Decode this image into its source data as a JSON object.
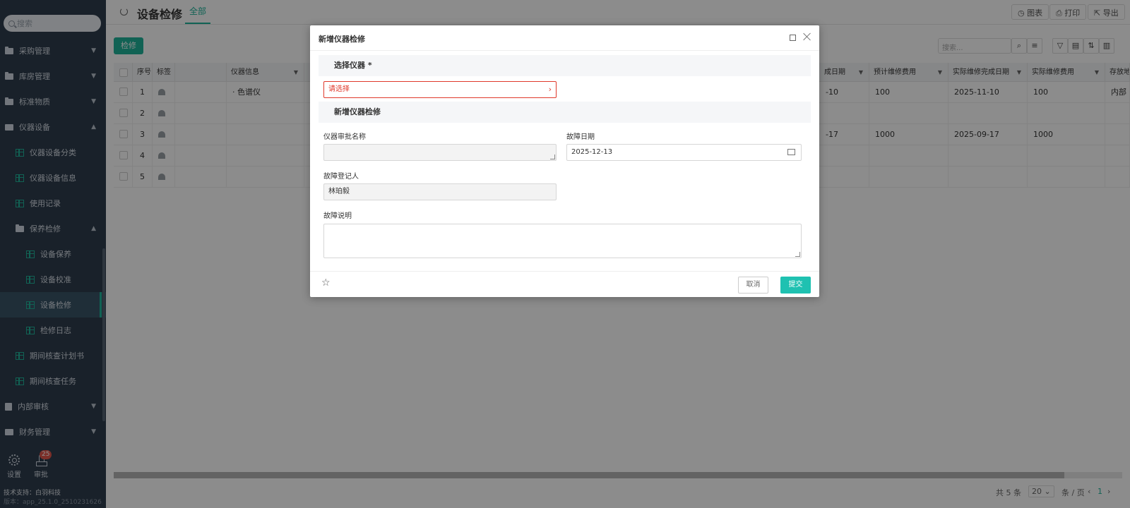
{
  "sidebar": {
    "search_placeholder": "搜索",
    "items": [
      {
        "label": "采购管理"
      },
      {
        "label": "库房管理"
      },
      {
        "label": "标准物质"
      },
      {
        "label": "仪器设备"
      },
      {
        "label": "仪器设备分类"
      },
      {
        "label": "仪器设备信息"
      },
      {
        "label": "使用记录"
      },
      {
        "label": "保养检修"
      },
      {
        "label": "设备保养"
      },
      {
        "label": "设备校准"
      },
      {
        "label": "设备检修"
      },
      {
        "label": "检修日志"
      },
      {
        "label": "期间核查计划书"
      },
      {
        "label": "期间核查任务"
      },
      {
        "label": "内部审核"
      },
      {
        "label": "财务管理"
      }
    ],
    "settings_label": "设置",
    "approve_label": "审批",
    "approve_badge": "25",
    "footer_support": "技术支持：白羽科技",
    "footer_version": "版本：app_25.1.0_2510231626..."
  },
  "topbar": {
    "title": "设备检修",
    "tab": "全部",
    "chart_btn": "◷ 图表",
    "print_btn": "⎙ 打印",
    "export_btn": "⇱ 导出"
  },
  "toolbar": {
    "repair_btn": "检修",
    "search_placeholder": "搜索..."
  },
  "table": {
    "headers": {
      "seq": "序号",
      "tag": "标签",
      "instrument": "仪器信息",
      "complete_date": "成日期",
      "est_cost": "预计维修费用",
      "actual_date": "实际维修完成日期",
      "actual_cost": "实际维修费用",
      "storage": "存放地"
    },
    "rows": [
      {
        "seq": "1",
        "instrument": "· 色谱仪",
        "complete_date": "-10",
        "est_cost": "100",
        "actual_date": "2025-11-10",
        "actual_cost": "100",
        "storage": "内部"
      },
      {
        "seq": "2",
        "instrument": "",
        "complete_date": "",
        "est_cost": "",
        "actual_date": "",
        "actual_cost": "",
        "storage": ""
      },
      {
        "seq": "3",
        "instrument": "",
        "complete_date": "-17",
        "est_cost": "1000",
        "actual_date": "2025-09-17",
        "actual_cost": "1000",
        "storage": ""
      },
      {
        "seq": "4",
        "instrument": "",
        "complete_date": "",
        "est_cost": "",
        "actual_date": "",
        "actual_cost": "",
        "storage": ""
      },
      {
        "seq": "5",
        "instrument": "",
        "complete_date": "",
        "est_cost": "",
        "actual_date": "",
        "actual_cost": "",
        "storage": ""
      }
    ]
  },
  "pager": {
    "total": "共 5 条",
    "page_size": "20",
    "per_page": "条 / 页",
    "page": "1"
  },
  "modal": {
    "title": "新增仪器检修",
    "section1": "选择仪器 *",
    "select_placeholder": "请选择",
    "section2": "新增仪器检修",
    "approval_name_label": "仪器审批名称",
    "approval_name_value": "",
    "fault_date_label": "故障日期",
    "fault_date_value": "2025-12-13",
    "registrant_label": "故障登记人",
    "registrant_value": "林珀毅",
    "desc_label": "故障说明",
    "desc_value": "",
    "cancel": "取消",
    "submit": "提交"
  }
}
